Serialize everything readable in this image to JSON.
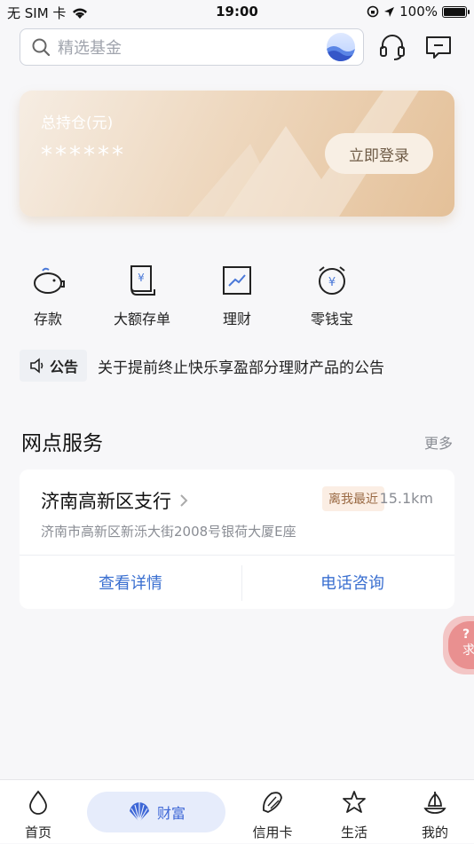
{
  "status_bar": {
    "carrier": "无 SIM 卡",
    "time": "19:00",
    "battery": "100%"
  },
  "search": {
    "placeholder": "精选基金"
  },
  "asset": {
    "title": "总持仓(元)",
    "masked_value": "******",
    "login_label": "立即登录"
  },
  "quick_actions": [
    {
      "label": "存款",
      "icon": "piggy-bank-icon"
    },
    {
      "label": "大额存单",
      "icon": "certificate-icon"
    },
    {
      "label": "理财",
      "icon": "trend-chart-icon"
    },
    {
      "label": "零钱宝",
      "icon": "yuan-clock-icon"
    }
  ],
  "notice": {
    "tag": "公告",
    "text": "关于提前终止快乐享盈部分理财产品的公告"
  },
  "branch_section": {
    "title": "网点服务",
    "more": "更多",
    "branch": {
      "name": "济南高新区支行",
      "badge": "离我最近",
      "distance": "15.1km",
      "address": "济南市高新区新泺大街2008号银荷大厦E座",
      "detail_label": "查看详情",
      "call_label": "电话咨询"
    }
  },
  "float_help": {
    "text": "求"
  },
  "tabs": [
    {
      "label": "首页",
      "icon": "drop-icon"
    },
    {
      "label": "财富",
      "icon": "shell-icon",
      "active": true
    },
    {
      "label": "信用卡",
      "icon": "conch-icon"
    },
    {
      "label": "生活",
      "icon": "starfish-icon"
    },
    {
      "label": "我的",
      "icon": "sailboat-icon"
    }
  ],
  "colors": {
    "accent": "#3d66d6",
    "card_gold": "#e4c098",
    "link_blue": "#3a6fd0"
  }
}
